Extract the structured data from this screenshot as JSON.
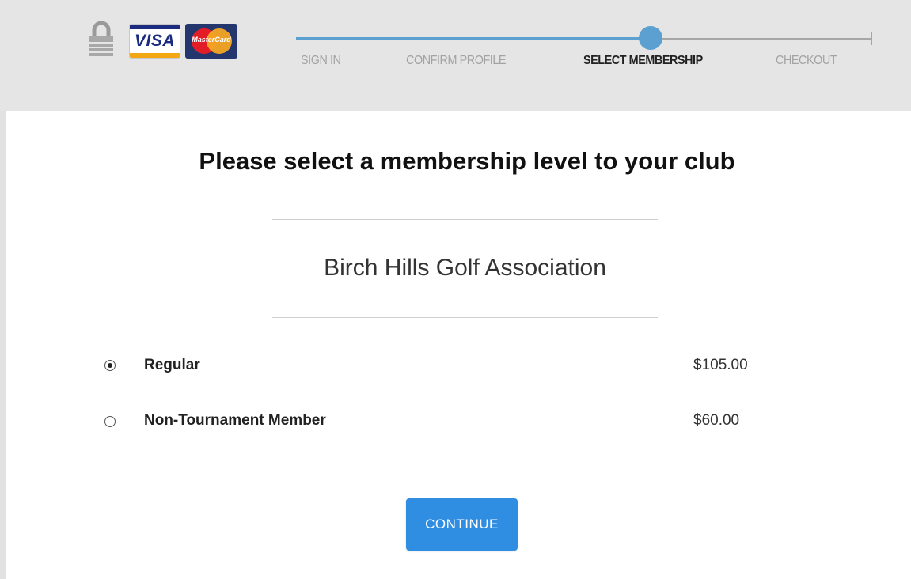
{
  "header": {
    "payment_cards": [
      {
        "name": "visa-card-icon",
        "label": "VISA"
      },
      {
        "name": "mastercard-icon",
        "label": "MasterCard"
      }
    ],
    "steps": [
      {
        "label": "SIGN IN",
        "state": "done"
      },
      {
        "label": "CONFIRM PROFILE",
        "state": "done"
      },
      {
        "label": "SELECT MEMBERSHIP",
        "state": "current"
      },
      {
        "label": "CHECKOUT",
        "state": "upcoming"
      }
    ],
    "progress_color": "#5ba0d0",
    "background_color": "#e5e5e5"
  },
  "main": {
    "title": "Please select a membership level to your club",
    "club_name": "Birch Hills Golf Association",
    "options": [
      {
        "label": "Regular",
        "price": "$105.00",
        "selected": true
      },
      {
        "label": "Non-Tournament Member",
        "price": "$60.00",
        "selected": false
      }
    ],
    "continue_label": "CONTINUE",
    "accent_color": "#2f8ee2"
  }
}
